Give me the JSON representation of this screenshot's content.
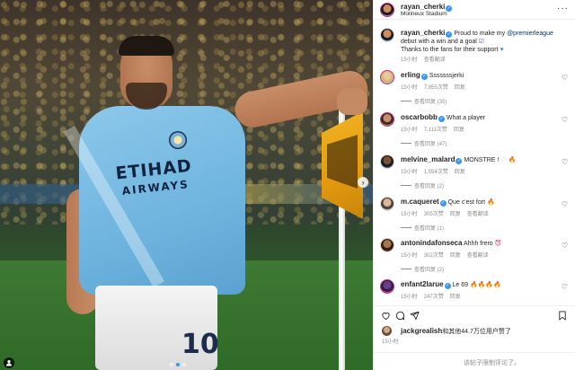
{
  "post": {
    "author": "rayan_cherki",
    "location": "Molineux Stadium",
    "photo": {
      "sponsor_line1": "ETIHAD",
      "sponsor_line2": "AIRWAYS",
      "shirt_number": "10"
    },
    "caption": {
      "user": "rayan_cherki",
      "text_before": "Proud to make my ",
      "mention": "@premierleague",
      "text_after_mention": " debut with a win and a goal ",
      "line2": "Thanks to the fans for their support ",
      "time": "15小时"
    },
    "translate_label": "查看翻译"
  },
  "comments": [
    {
      "user": "erling",
      "text": "Sssssssjerki",
      "time": "15小时",
      "likes": "7,955次赞",
      "reply": "回复",
      "view_replies": "查看回复 (35)"
    },
    {
      "user": "oscarbobb",
      "text": "What a player",
      "time": "15小时",
      "likes": "7,111次赞",
      "reply": "回复",
      "view_replies": "查看回复 (47)"
    },
    {
      "user": "melvine_malard",
      "text": "MONSTRE ! ",
      "time": "15小时",
      "likes": "1,554次赞",
      "reply": "回复",
      "view_replies": "查看回复 (2)"
    },
    {
      "user": "m.caqueret",
      "text": "Que c'est fort ",
      "time": "15小时",
      "likes": "305次赞",
      "reply": "回复",
      "translate": "查看翻译",
      "view_replies": "查看回复 (1)"
    },
    {
      "user": "antonindafonseca",
      "text": "Ahhh frero ",
      "time": "15小时",
      "likes": "302次赞",
      "reply": "回复",
      "translate": "查看翻译",
      "view_replies": "查看回复 (2)"
    },
    {
      "user": "enfant2larue",
      "text": "Le 69 ",
      "time": "15小时",
      "likes": "247次赞",
      "reply": "回复"
    }
  ],
  "likes_line": {
    "user": "jackgrealish",
    "text": "和其他44.7万位用户赞了"
  },
  "post_time": "15小时",
  "add_comment_placeholder": "该帖子限制评论了。",
  "icons": {
    "more": "more-dots-icon",
    "heart": "heart-icon",
    "comment": "comment-icon",
    "share": "share-icon",
    "save": "bookmark-icon",
    "next": "chevron-right-icon",
    "verified": "verified-badge-icon",
    "user_tag": "user-tag-icon"
  },
  "colors": {
    "verified_blue": "#3897f0",
    "meta_gray": "#8e8e8e",
    "text": "#262626",
    "mention": "#00376b"
  },
  "carousel": {
    "current_index": 1,
    "total": 3
  }
}
